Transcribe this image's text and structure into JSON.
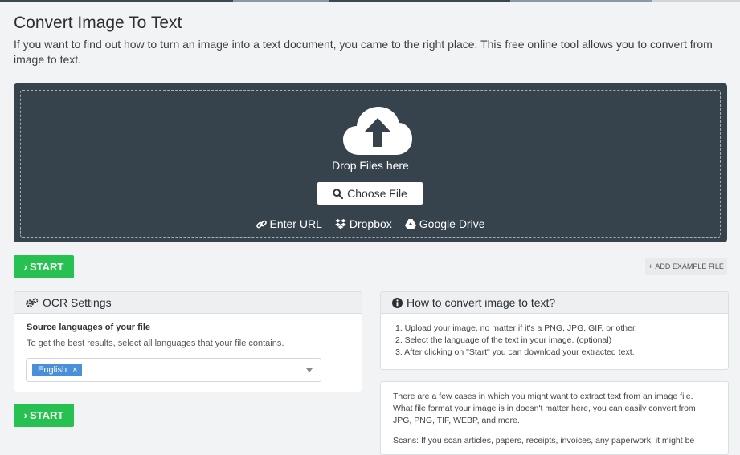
{
  "colors": {
    "topbar": [
      "#3d4750",
      "#8a9aa5",
      "#3d4750",
      "#8a9aa5",
      "#cfd6db"
    ],
    "dropzone_bg": "#37434c",
    "start_green": "#27c151",
    "chip_blue": "#4a90d9"
  },
  "page": {
    "title": "Convert Image To Text",
    "intro": "If you want to find out how to turn an image into a text document, you came to the right place. This free online tool allows you to convert from image to text."
  },
  "upload": {
    "cloud_icon": "cloud-upload-icon",
    "drop_label": "Drop Files here",
    "choose_label": "Choose File",
    "sources": [
      {
        "label": "Enter URL",
        "icon": "link-icon"
      },
      {
        "label": "Dropbox",
        "icon": "dropbox-icon"
      },
      {
        "label": "Google Drive",
        "icon": "google-drive-icon"
      }
    ]
  },
  "actions": {
    "start_label": "START",
    "add_example_label": "ADD EXAMPLE FILE"
  },
  "ocr": {
    "title": "OCR Settings",
    "source_label": "Source languages of your file",
    "hint": "To get the best results, select all languages that your file contains.",
    "selected_language": "English",
    "remove_symbol": "×"
  },
  "howto": {
    "title": "How to convert image to text?",
    "steps": [
      "1. Upload your image, no matter if it's a PNG, JPG, GIF, or other.",
      "2. Select the language of the text in your image. (optional)",
      "3. After clicking on \"Start\" you can download your extracted text."
    ]
  },
  "info": {
    "p1": "There are a few cases in which you might want to extract text from an image file. What file format your image is in doesn't matter here, you can easily convert from JPG, PNG, TIF, WEBP, and more.",
    "p2": "Scans: If you scan articles, papers, receipts, invoices, any paperwork, it might be"
  }
}
